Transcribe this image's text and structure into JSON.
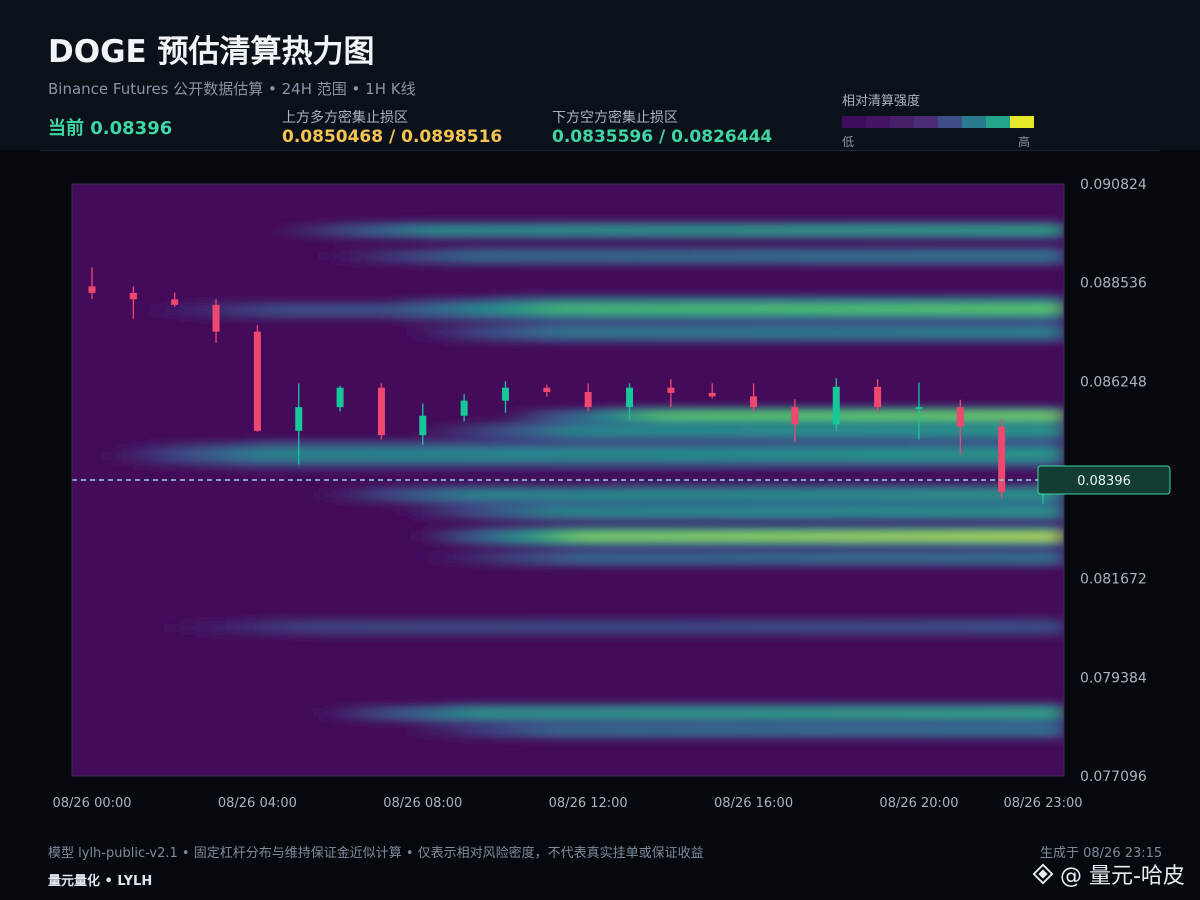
{
  "header": {
    "title": "DOGE 预估清算热力图",
    "subtitle": "Binance Futures 公开数据估算 • 24H 范围 • 1H K线",
    "current_label": "当前 0.08396",
    "upper_label": "上方多方密集止损区",
    "upper_value": "0.0850468 / 0.0898516",
    "lower_label": "下方空方密集止损区",
    "lower_value": "0.0835596 / 0.0826444"
  },
  "legend": {
    "title": "相对清算强度",
    "low": "低",
    "high": "高",
    "colors": [
      "#3b0d5c",
      "#431562",
      "#48206a",
      "#4a2d76",
      "#3c4d87",
      "#2a7a8e",
      "#23a58a",
      "#e6e92a"
    ]
  },
  "footer": {
    "note": "模型 lylh-public-v2.1 • 固定杠杆分布与维持保证金近似计算 • 仅表示相对风险密度，不代表真实挂单或保证收益",
    "brand": "量元量化 • LYLH",
    "generated": "生成于 08/26 23:15",
    "watermark": "@ 量元-哈皮"
  },
  "chart_data": {
    "type": "heatmap",
    "ylim": [
      0.077096,
      0.090824
    ],
    "y_ticks": [
      "0.090824",
      "0.088536",
      "0.086248",
      "0.083960",
      "0.081672",
      "0.079384",
      "0.077096"
    ],
    "y_tick_values": [
      0.090824,
      0.088536,
      0.086248,
      0.08396,
      0.081672,
      0.079384,
      0.077096
    ],
    "y_tick_labels": [
      "0.090824",
      "0.088536",
      "0.086248",
      "",
      "0.081672",
      "0.079384",
      "0.077096"
    ],
    "x_ticks": [
      "08/26 00:00",
      "08/26 04:00",
      "08/26 08:00",
      "08/26 12:00",
      "08/26 16:00",
      "08/26 20:00",
      "08/26 23:00"
    ],
    "x_tick_hours": [
      0,
      4,
      8,
      12,
      16,
      20,
      23
    ],
    "current_price": 0.08396,
    "current_price_label": "0.08396",
    "colors": {
      "up": "#16c79a",
      "down": "#ef476f",
      "current": "#8fd3ea",
      "frame": "#3a2f4f"
    },
    "bands": [
      {
        "price": 0.08975,
        "intensity": 0.6,
        "start": 4.5,
        "sigma": 0.00011
      },
      {
        "price": 0.08915,
        "intensity": 0.42,
        "start": 5.5,
        "sigma": 0.00012
      },
      {
        "price": 0.08795,
        "intensity": 0.48,
        "start": 7.5,
        "sigma": 0.00016
      },
      {
        "price": 0.08738,
        "intensity": 0.46,
        "start": 7.5,
        "sigma": 0.00014
      },
      {
        "price": 0.0879,
        "intensity": 0.3,
        "start": 1.0,
        "sigma": 0.00014
      },
      {
        "price": 0.08545,
        "intensity": 0.85,
        "start": 10.0,
        "sigma": 0.0001
      },
      {
        "price": 0.0851,
        "intensity": 0.55,
        "start": 8.0,
        "sigma": 0.00013
      },
      {
        "price": 0.08455,
        "intensity": 0.55,
        "start": 0.5,
        "sigma": 0.00018
      },
      {
        "price": 0.08362,
        "intensity": 0.55,
        "start": 5.5,
        "sigma": 0.00013
      },
      {
        "price": 0.08322,
        "intensity": 0.55,
        "start": 7.5,
        "sigma": 0.00012
      },
      {
        "price": 0.08265,
        "intensity": 0.95,
        "start": 8.0,
        "sigma": 0.00012
      },
      {
        "price": 0.08215,
        "intensity": 0.4,
        "start": 8.0,
        "sigma": 0.00012
      },
      {
        "price": 0.08055,
        "intensity": 0.25,
        "start": 1.5,
        "sigma": 0.00014
      },
      {
        "price": 0.07855,
        "intensity": 0.62,
        "start": 5.5,
        "sigma": 0.00012
      },
      {
        "price": 0.07815,
        "intensity": 0.4,
        "start": 7.5,
        "sigma": 0.00012
      }
    ],
    "candles": [
      {
        "t": 0,
        "o": 0.08845,
        "h": 0.08889,
        "l": 0.08816,
        "c": 0.0883
      },
      {
        "t": 1,
        "o": 0.0883,
        "h": 0.08845,
        "l": 0.0877,
        "c": 0.08815
      },
      {
        "t": 2,
        "o": 0.08815,
        "h": 0.08831,
        "l": 0.08798,
        "c": 0.08802
      },
      {
        "t": 3,
        "o": 0.08802,
        "h": 0.08815,
        "l": 0.08714,
        "c": 0.0874
      },
      {
        "t": 4,
        "o": 0.0874,
        "h": 0.08755,
        "l": 0.08508,
        "c": 0.0851
      },
      {
        "t": 5,
        "o": 0.0851,
        "h": 0.0862,
        "l": 0.08432,
        "c": 0.08565
      },
      {
        "t": 6,
        "o": 0.08565,
        "h": 0.08615,
        "l": 0.08555,
        "c": 0.0861
      },
      {
        "t": 7,
        "o": 0.0861,
        "h": 0.0862,
        "l": 0.0849,
        "c": 0.085
      },
      {
        "t": 8,
        "o": 0.085,
        "h": 0.08573,
        "l": 0.08478,
        "c": 0.08545
      },
      {
        "t": 9,
        "o": 0.08545,
        "h": 0.08595,
        "l": 0.08532,
        "c": 0.0858
      },
      {
        "t": 10,
        "o": 0.0858,
        "h": 0.08625,
        "l": 0.08552,
        "c": 0.0861
      },
      {
        "t": 11,
        "o": 0.0861,
        "h": 0.08617,
        "l": 0.08589,
        "c": 0.086
      },
      {
        "t": 12,
        "o": 0.086,
        "h": 0.0862,
        "l": 0.08555,
        "c": 0.08565
      },
      {
        "t": 13,
        "o": 0.08565,
        "h": 0.0862,
        "l": 0.08535,
        "c": 0.0861
      },
      {
        "t": 14,
        "o": 0.0861,
        "h": 0.0863,
        "l": 0.08565,
        "c": 0.08598
      },
      {
        "t": 15,
        "o": 0.08598,
        "h": 0.0862,
        "l": 0.08585,
        "c": 0.0859
      },
      {
        "t": 16,
        "o": 0.0859,
        "h": 0.0862,
        "l": 0.08555,
        "c": 0.08565
      },
      {
        "t": 17,
        "o": 0.08565,
        "h": 0.08583,
        "l": 0.08485,
        "c": 0.08525
      },
      {
        "t": 18,
        "o": 0.08525,
        "h": 0.08632,
        "l": 0.0851,
        "c": 0.08612
      },
      {
        "t": 19,
        "o": 0.08612,
        "h": 0.0863,
        "l": 0.08555,
        "c": 0.08565
      },
      {
        "t": 20,
        "o": 0.08565,
        "h": 0.08622,
        "l": 0.0849,
        "c": 0.08565
      },
      {
        "t": 21,
        "o": 0.08565,
        "h": 0.08582,
        "l": 0.08455,
        "c": 0.0852
      },
      {
        "t": 22,
        "o": 0.0852,
        "h": 0.08538,
        "l": 0.08352,
        "c": 0.08368
      },
      {
        "t": 23,
        "o": 0.08368,
        "h": 0.08416,
        "l": 0.0834,
        "c": 0.08396
      }
    ]
  }
}
